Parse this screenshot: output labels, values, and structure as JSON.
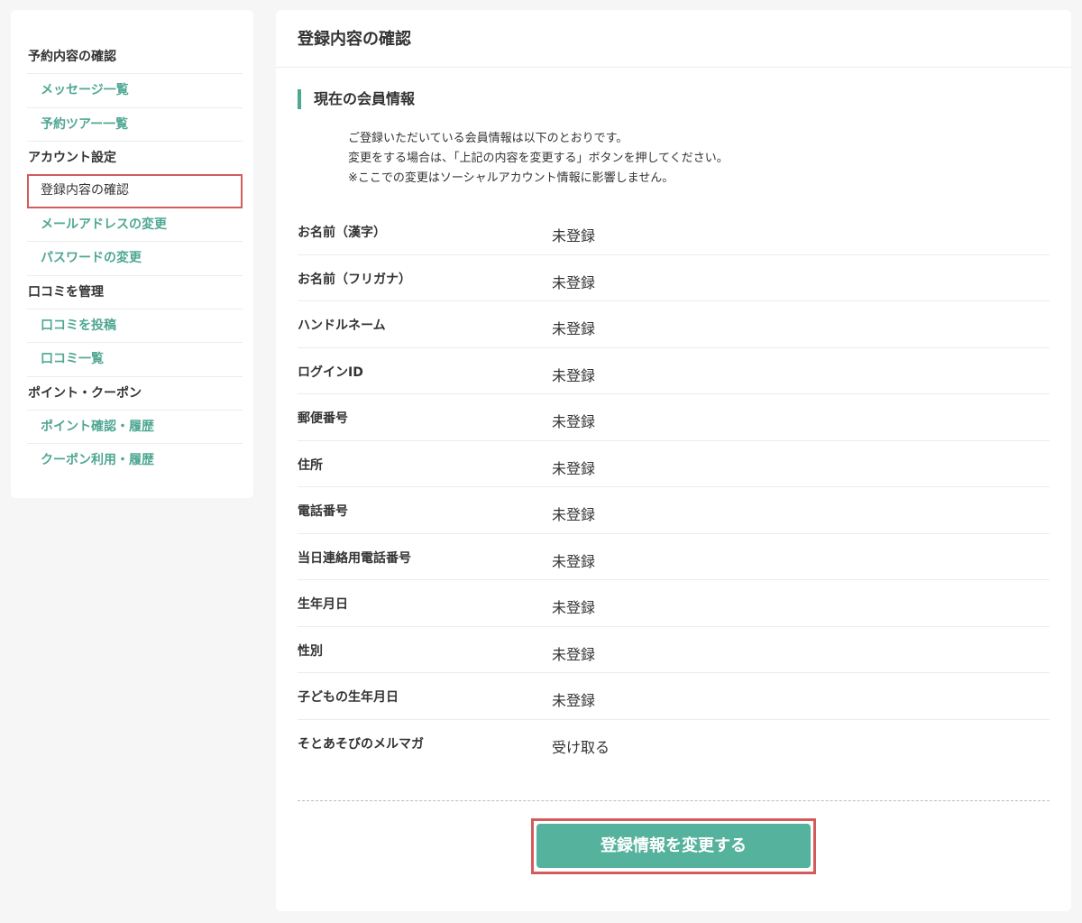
{
  "sidebar": {
    "groups": [
      {
        "heading": "予約内容の確認",
        "links": [
          "メッセージ一覧",
          "予約ツアー一覧"
        ]
      },
      {
        "heading": "アカウント設定",
        "links": [
          "登録内容の確認",
          "メールアドレスの変更",
          "パスワードの変更"
        ]
      },
      {
        "heading": "口コミを管理",
        "links": [
          "口コミを投稿",
          "口コミ一覧"
        ]
      },
      {
        "heading": "ポイント・クーポン",
        "links": [
          "ポイント確認・履歴",
          "クーポン利用・履歴"
        ]
      }
    ],
    "active": "登録内容の確認"
  },
  "main": {
    "title": "登録内容の確認",
    "section_title": "現在の会員情報",
    "intro": [
      "ご登録いただいている会員情報は以下のとおりです。",
      "変更をする場合は、「上記の内容を変更する」ボタンを押してください。",
      "※ここでの変更はソーシャルアカウント情報に影響しません。"
    ],
    "rows": [
      {
        "label": "お名前（漢字）",
        "value": "未登録"
      },
      {
        "label": "お名前（フリガナ）",
        "value": "未登録"
      },
      {
        "label": "ハンドルネーム",
        "value": "未登録"
      },
      {
        "label": "ログインID",
        "value": "未登録"
      },
      {
        "label": "郵便番号",
        "value": "未登録"
      },
      {
        "label": "住所",
        "value": "未登録"
      },
      {
        "label": "電話番号",
        "value": "未登録"
      },
      {
        "label": "当日連絡用電話番号",
        "value": "未登録"
      },
      {
        "label": "生年月日",
        "value": "未登録"
      },
      {
        "label": "性別",
        "value": "未登録"
      },
      {
        "label": "子どもの生年月日",
        "value": "未登録"
      },
      {
        "label": "そとあそびのメルマガ",
        "value": "受け取る"
      }
    ],
    "change_button": "登録情報を変更する"
  },
  "colors": {
    "accent": "#55b29c",
    "link": "#4fa793",
    "highlight": "#d35b5b"
  }
}
